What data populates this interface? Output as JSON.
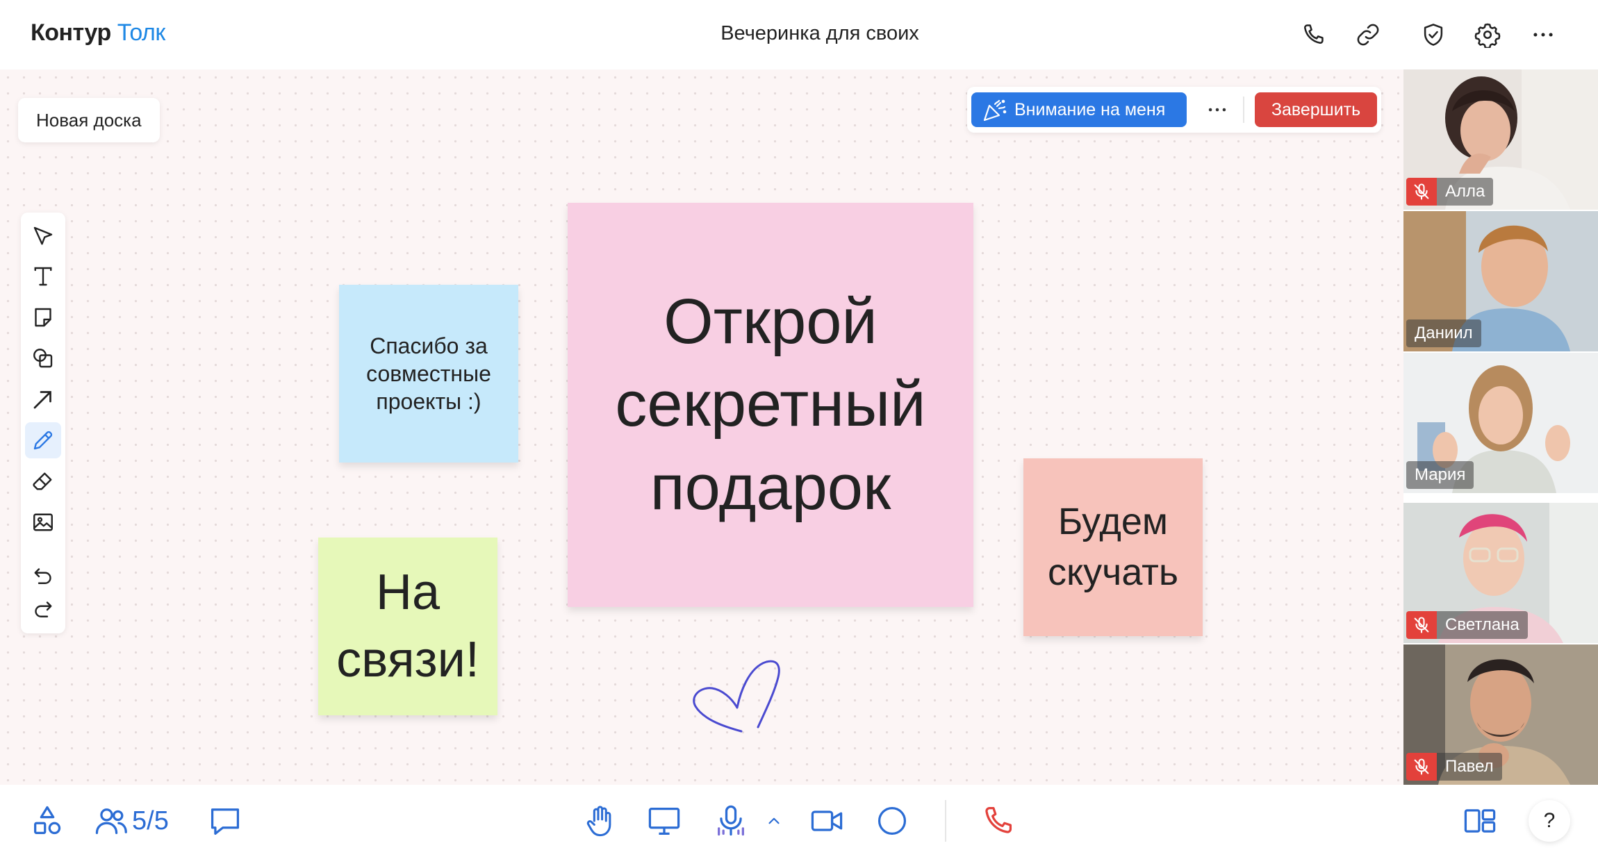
{
  "app": {
    "brand": "Контур",
    "product": "Толк"
  },
  "meeting": {
    "title": "Вечеринка для своих"
  },
  "header_icons": [
    "phone-icon",
    "link-icon",
    "shield-check-icon",
    "gear-icon",
    "more-icon"
  ],
  "board": {
    "name": "Новая доска"
  },
  "actionbar": {
    "attention_label": "Внимание на меня",
    "more_label": "···",
    "end_label": "Завершить"
  },
  "tools": [
    "select",
    "text",
    "sticky-note",
    "shapes",
    "arrow",
    "pen",
    "eraser",
    "image",
    "undo",
    "redo"
  ],
  "active_tool": "pen",
  "notes": {
    "thanks": [
      "Спасибо за",
      "совместные",
      "проекты :)"
    ],
    "gift": [
      "Открой",
      "секретный",
      "подарок"
    ],
    "touch": [
      "На",
      "связи!"
    ],
    "miss": [
      "Будем",
      "скучать"
    ]
  },
  "participants": [
    {
      "name": "Алла",
      "muted": true,
      "speaking": false
    },
    {
      "name": "Даниил",
      "muted": false,
      "speaking": false
    },
    {
      "name": "Мария",
      "muted": false,
      "speaking": true
    },
    {
      "name": "Светлана",
      "muted": true,
      "speaking": false
    },
    {
      "name": "Павел",
      "muted": true,
      "speaking": false
    }
  ],
  "bottombar": {
    "participants_count": "5/5",
    "help_label": "?"
  },
  "colors": {
    "accent": "#2b78e4",
    "danger": "#d9453f",
    "note_blue": "#c6e9fb",
    "note_pink": "#f8cfe3",
    "note_green": "#e6f8b9",
    "note_salmon": "#f7c3bb"
  }
}
